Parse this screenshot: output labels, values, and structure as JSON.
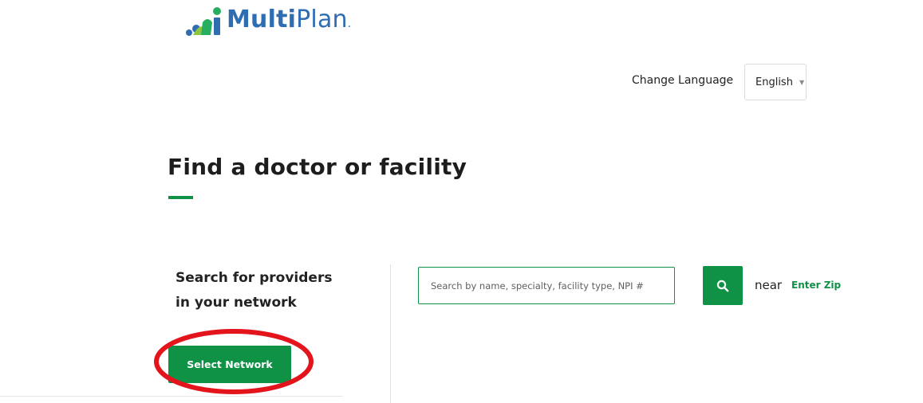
{
  "brand": {
    "logo_bold": "Multi",
    "logo_light": "Plan",
    "logo_dot": ".",
    "colors": {
      "logo_blue": "#2f6db3",
      "logo_green": "#27ae60",
      "logo_light_green": "#8cc63f",
      "accent_green": "#0f9146",
      "annotation_red": "#e3141b"
    }
  },
  "language": {
    "label": "Change Language",
    "selected": "English"
  },
  "page": {
    "title": "Find a doctor or facility"
  },
  "network_panel": {
    "heading_line1": "Search for providers",
    "heading_line2": "in your network",
    "button_label": "Select Network"
  },
  "search": {
    "placeholder": "Search by name, specialty, facility type, NPI #",
    "value": "",
    "button_icon": "search-icon",
    "near_label": "near",
    "zip_link": "Enter Zip"
  }
}
